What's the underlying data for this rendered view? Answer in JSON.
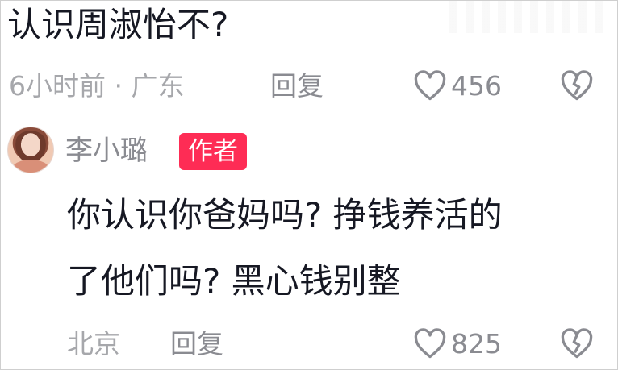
{
  "comment": {
    "text": "认识周淑怡不?",
    "time_location": "6小时前 · 广东",
    "reply_label": "回复",
    "like_count": "456"
  },
  "reply": {
    "username": "李小璐",
    "badge": "作者",
    "text_line1": "你认识你爸妈吗? 挣钱养活的",
    "text_line2": "了他们吗? 黑心钱别整",
    "location": "北京",
    "reply_label": "回复",
    "like_count": "825"
  },
  "icons": {
    "like": "heart-icon",
    "dislike": "broken-heart-icon",
    "avatar": "avatar"
  },
  "colors": {
    "text": "#161823",
    "meta": "#a6a7ab",
    "badge": "#fe2c55"
  }
}
